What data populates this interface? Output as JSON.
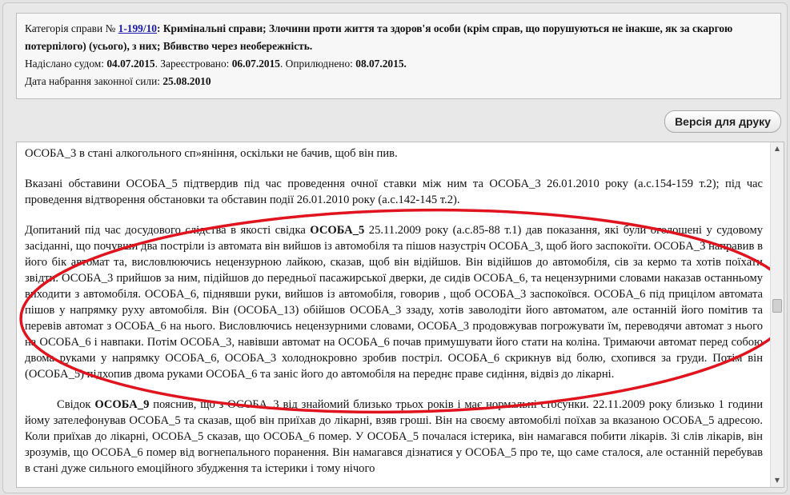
{
  "case_info": {
    "category_label": "Категорія справи № ",
    "case_number": "1-199/10",
    "category_colon": ": ",
    "category_text": "Кримінальні справи; Злочини проти життя та здоров'я особи (крім справ, що порушуються не інакше, як за скаргою потерпілого) (усього), з них; Вбивство через необережність.",
    "sent_label": "Надіслано судом: ",
    "sent_date": "04.07.2015",
    "registered_label": ". Зареєстровано: ",
    "registered_date": "06.07.2015",
    "published_label": ". Оприлюднено: ",
    "published_date": "08.07.2015",
    "period": ".",
    "effective_label": "Дата набрання законної сили: ",
    "effective_date": "25.08.2010"
  },
  "print_button": {
    "label": "Версія для друку"
  },
  "document": {
    "p1": "ОСОБА_3 в стані алкогольного сп»яніння, оскільки не бачив, щоб він пив.",
    "p2": "Вказані обставини ОСОБА_5 підтвердив під час проведення очної ставки між ним та ОСОБА_3 26.01.2010 року (а.с.154-159 т.2); під час проведення відтворення обстановки та обставин події 26.01.2010 року (а.с.142-145 т.2).",
    "p3_a": "Допитаний під час досудового слідства в якості свідка ",
    "p3_name": "ОСОБА_5",
    "p3_b": " 25.11.2009 року (а.с.85-88 т.1) дав показання, які були оголошені у судовому засіданні, що почувши два постріли із автомата він вийшов із автомобіля та пішов назустріч ОСОБА_3, щоб його заспокоїти. ОСОБА_3 направив в його бік автомат та, висловлюючись нецензурною лайкою, сказав, щоб він відійшов. Він відійшов до автомобіля, сів за кермо та хотів поїхати звідти. ОСОБА_3 прийшов за ним, підійшов до передньої пасажирської дверки, де сидів ОСОБА_6, та нецензурними словами наказав останньому виходити з автомобіля. ОСОБА_6, піднявши руки, вийшов із автомобіля, говорив , щоб ОСОБА_3 заспокоївся. ОСОБА_6 під прицілом автомата пішов у напрямку руху автомобіля. Він (ОСОБА_13) обійшов ОСОБА_3 ззаду, хотів заволодіти його автоматом, але останній його помітив та перевів автомат з ОСОБА_6 на нього. Висловлючись нецензурними словами, ОСОБА_3 продовжував погрожувати їм, переводячи автомат з нього на ОСОБА_6 і навпаки. Потім ОСОБА_3, навівши автомат на ОСОБА_6 почав примушувати його стати на коліна. Тримаючи автомат перед собою двома руками у напрямку ОСОБА_6, ОСОБА_3 холоднокровно зробив постріл. ОСОБА_6 скрикнув від болю, схопився за груди. Потім він (ОСОБА_5) підхопив двома руками ОСОБА_6 та заніс його до автомобіля на переднє праве сидіння, відвіз до лікарні.",
    "p4_a": "Свідок ",
    "p4_name": "ОСОБА_9",
    "p4_b": " пояснив, що з ОСОБА_3 від знайомий близько трьох років і має нормальні стосунки. 22.11.2009 року близько 1 години йому зателефонував ОСОБА_5 та сказав, щоб він приїхав до лікарні, взяв гроші. Він на своєму автомобілі поїхав за вказаною ОСОБА_5 адресою. Коли приїхав до лікарні, ОСОБА_5 сказав, що ОСОБА_6 помер. У ОСОБА_5 почалася істерика, він намагався побити лікарів. Зі слів лікарів, він зрозумів, що ОСОБА_6 помер від вогнепального поранення. Він намагався дізнатися у ОСОБА_5 про те, що саме сталося, але останній перебував в стані дуже сильного емоційного збудження та істерики і тому нічого"
  },
  "scrollbar": {
    "position": 0.47
  },
  "colors": {
    "annotation_ellipse": "#e0141e",
    "link": "#1a1aa6"
  }
}
